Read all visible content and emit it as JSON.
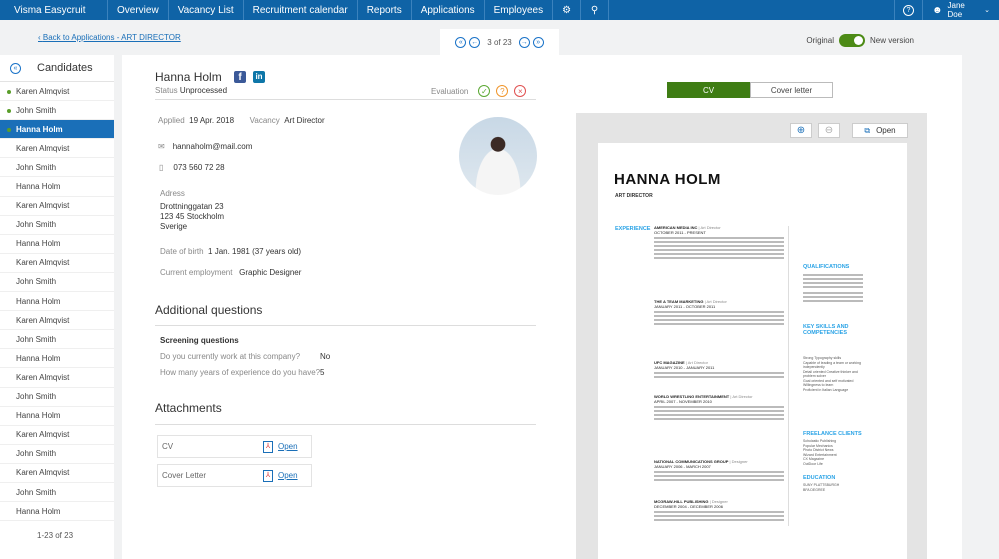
{
  "nav": {
    "brand": "Visma Easycruit",
    "items": [
      "Overview",
      "Vacancy List",
      "Recruitment calendar",
      "Reports",
      "Applications",
      "Employees"
    ],
    "user": "Jane Doe"
  },
  "back_link": "Back to Applications - ART DIRECTOR",
  "pager": {
    "text": "3 of 23"
  },
  "version": {
    "original": "Original",
    "new": "New version",
    "new_enabled": true
  },
  "sidebar": {
    "title": "Candidates",
    "footer": "1-23 of 23",
    "selected_index": 2,
    "candidates": [
      {
        "name": "Karen Almqvist",
        "new": true
      },
      {
        "name": "John Smith",
        "new": true
      },
      {
        "name": "Hanna Holm",
        "new": true
      },
      {
        "name": "Karen Almqvist"
      },
      {
        "name": "John Smith"
      },
      {
        "name": "Hanna Holm"
      },
      {
        "name": "Karen Almqvist"
      },
      {
        "name": "John Smith"
      },
      {
        "name": "Hanna Holm"
      },
      {
        "name": "Karen Almqvist"
      },
      {
        "name": "John Smith"
      },
      {
        "name": "Hanna Holm"
      },
      {
        "name": "Karen Almqvist"
      },
      {
        "name": "John Smith"
      },
      {
        "name": "Hanna Holm"
      },
      {
        "name": "Karen Almqvist"
      },
      {
        "name": "John Smith"
      },
      {
        "name": "Hanna Holm"
      },
      {
        "name": "Karen Almqvist"
      },
      {
        "name": "John Smith"
      },
      {
        "name": "Karen Almqvist"
      },
      {
        "name": "John Smith"
      },
      {
        "name": "Hanna Holm"
      }
    ]
  },
  "candidate": {
    "name": "Hanna Holm",
    "status_label": "Status",
    "status": "Unprocessed",
    "evaluation_label": "Evaluation",
    "applied_label": "Applied",
    "applied": "19 Apr. 2018",
    "vacancy_label": "Vacancy",
    "vacancy": "Art Director",
    "email": "hannaholm@mail.com",
    "phone": "073 560 72 28",
    "address_label": "Adress",
    "address": [
      "Drottninggatan 23",
      "123 45 Stockholm",
      "Sverige"
    ],
    "dob_label": "Date of birth",
    "dob": "1 Jan. 1981 (37 years old)",
    "employment_label": "Current employment",
    "employment": "Graphic Designer"
  },
  "questions": {
    "title": "Additional questions",
    "subtitle": "Screening questions",
    "items": [
      {
        "q": "Do you currently work at this company?",
        "a": "No"
      },
      {
        "q": "How many years of experience do you have?",
        "a": "5"
      }
    ]
  },
  "attachments": {
    "title": "Attachments",
    "items": [
      {
        "name": "CV",
        "action": "Open"
      },
      {
        "name": "Cover Letter",
        "action": "Open"
      }
    ]
  },
  "viewer": {
    "tabs": [
      "CV",
      "Cover letter"
    ],
    "active_tab": 0,
    "open_label": "Open",
    "cv": {
      "name": "HANNA HOLM",
      "title": "ART DIRECTOR",
      "experience_label": "EXPERIENCE",
      "jobs": [
        {
          "company": "AMERICAN MEDIA INC",
          "role": "Art Director",
          "dates": "OCTOBER 2011 - PRESENT"
        },
        {
          "company": "THE A TEAM MARKETING",
          "role": "Art Director",
          "dates": "JANUARY 2011 - OCTOBER 2011"
        },
        {
          "company": "UFC MAGAZINE",
          "role": "Art Director",
          "dates": "JANUARY 2010 - JANUARY 2011"
        },
        {
          "company": "WORLD WRESTLING ENTERTAINMENT",
          "role": "Art Director",
          "dates": "APRIL 2007 - NOVEMBER 2010"
        },
        {
          "company": "NATIONAL COMMUNICATIONS GROUP",
          "role": "Designer",
          "dates": "JANUARY 2006 - MARCH 2007"
        },
        {
          "company": "MCGRAW-HILL PUBLISHING",
          "role": "Designer",
          "dates": "DECEMBER 2004 - DECEMBER 2006"
        }
      ],
      "qualifications_label": "QUALIFICATIONS",
      "skills_label": "KEY SKILLS AND COMPETENCIES",
      "skills": [
        "Strong Typography skills",
        "Capable of leading a team or working independently",
        "Detail oriented Creative thinker and problem solver",
        "Goal oriented and self motivated",
        "Willingness to learn",
        "Proficient in Italian Language"
      ],
      "clients_label": "FREELANCE CLIENTS",
      "clients": [
        "Scholastic Publishing",
        "Popular Mechanics",
        "Photo District News",
        "Wizard Entertainment",
        "CX Magazine",
        "OutDoor Life"
      ],
      "education_label": "EDUCATION",
      "education": [
        "SUNY PLATTSBURGH",
        "BFA DEGREE"
      ]
    }
  },
  "colors": {
    "nav": "#0f63a6",
    "selected": "#1a6fb8",
    "accent_green": "#3f7d14",
    "cv_heading": "#2aa3e6"
  }
}
